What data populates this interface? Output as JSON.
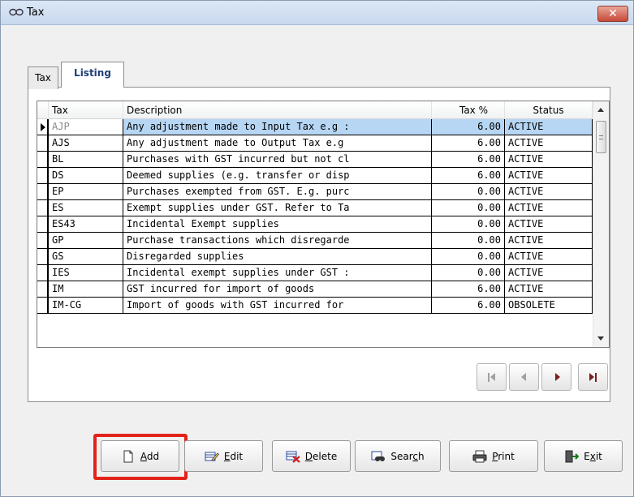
{
  "window": {
    "title": "Tax",
    "close_glyph": "✕"
  },
  "tabs": [
    {
      "label": "Tax",
      "active": false
    },
    {
      "label": "Listing",
      "active": true
    }
  ],
  "grid": {
    "columns": {
      "tax": "Tax",
      "description": "Description",
      "tax_pct": "Tax %",
      "status": "Status"
    },
    "rows": [
      {
        "tax": "AJP",
        "description": "Any adjustment made to Input Tax e.g :",
        "tax_pct": "6.00",
        "status": "ACTIVE"
      },
      {
        "tax": "AJS",
        "description": "Any adjustment made to Output Tax e.g",
        "tax_pct": "6.00",
        "status": "ACTIVE"
      },
      {
        "tax": "BL",
        "description": "Purchases with GST incurred but not cl",
        "tax_pct": "6.00",
        "status": "ACTIVE"
      },
      {
        "tax": "DS",
        "description": "Deemed supplies (e.g. transfer or disp",
        "tax_pct": "6.00",
        "status": "ACTIVE"
      },
      {
        "tax": "EP",
        "description": "Purchases exempted from GST. E.g. purc",
        "tax_pct": "0.00",
        "status": "ACTIVE"
      },
      {
        "tax": "ES",
        "description": "Exempt supplies under GST. Refer to Ta",
        "tax_pct": "0.00",
        "status": "ACTIVE"
      },
      {
        "tax": "ES43",
        "description": "Incidental Exempt supplies",
        "tax_pct": "0.00",
        "status": "ACTIVE"
      },
      {
        "tax": "GP",
        "description": "Purchase transactions which disregarde",
        "tax_pct": "0.00",
        "status": "ACTIVE"
      },
      {
        "tax": "GS",
        "description": "Disregarded supplies",
        "tax_pct": "0.00",
        "status": "ACTIVE"
      },
      {
        "tax": "IES",
        "description": "Incidental exempt supplies under GST :",
        "tax_pct": "0.00",
        "status": "ACTIVE"
      },
      {
        "tax": "IM",
        "description": "GST incurred for import of goods",
        "tax_pct": "6.00",
        "status": "ACTIVE"
      },
      {
        "tax": "IM-CG",
        "description": "Import of goods with GST incurred for",
        "tax_pct": "6.00",
        "status": "OBSOLETE"
      }
    ],
    "selected_row": 0
  },
  "navigator": {
    "first": "first-record-icon",
    "prev": "prev-record-icon",
    "next": "next-record-icon",
    "last": "last-record-icon"
  },
  "buttons": {
    "add": {
      "key": "A",
      "rest": "dd"
    },
    "edit": {
      "key": "E",
      "rest": "dit"
    },
    "delete": {
      "key": "D",
      "rest": "elete"
    },
    "search": {
      "pre": "Sear",
      "key": "c",
      "post": "h"
    },
    "print": {
      "key": "P",
      "rest": "rint"
    },
    "exit": {
      "pre": "E",
      "key": "x",
      "post": "it"
    }
  },
  "colors": {
    "highlight": "#e2231a",
    "selection": "#b7d6f4",
    "tab_active_text": "#1f3f79"
  }
}
